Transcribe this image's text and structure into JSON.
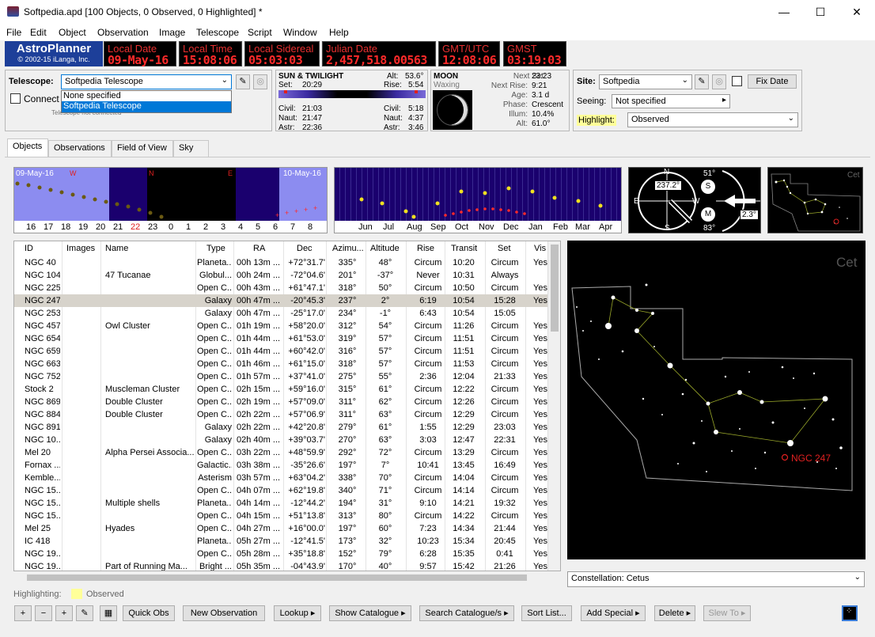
{
  "window": {
    "title": "Softpedia.apd [100 Objects, 0 Observed, 0 Highlighted] *",
    "minimize": "—",
    "maximize": "☐",
    "close": "✕"
  },
  "menu": [
    "File",
    "Edit",
    "Object",
    "Observation",
    "Image",
    "Telescope",
    "Script",
    "Window",
    "Help"
  ],
  "brand": {
    "name": "AstroPlanner",
    "copyright": "© 2002-15 iLanga, Inc."
  },
  "clocks": [
    {
      "label": "Local Date",
      "value": "09-May-16"
    },
    {
      "label": "Local Time",
      "value": "15:08:06"
    },
    {
      "label": "Local Sidereal",
      "value": "05:03:03"
    },
    {
      "label": "Julian Date",
      "value": "2,457,518.00563"
    },
    {
      "label": "GMT/UTC",
      "value": "12:08:06"
    },
    {
      "label": "GMST",
      "value": "03:19:03"
    }
  ],
  "telescope": {
    "label": "Telescope:",
    "selected": "Softpedia Telescope",
    "options": [
      "None specified",
      "Softpedia Telescope"
    ],
    "connect_label": "Connect t",
    "status": "Telescope not connected"
  },
  "sun": {
    "title": "SUN & TWILIGHT",
    "set_label": "Set:",
    "set": "20:29",
    "alt_label": "Alt:",
    "alt": "53.6°",
    "rise_label": "Rise:",
    "rise": "5:54",
    "civil_label": "Civil:",
    "civil_eve": "21:03",
    "civil_morn": "5:18",
    "naut_label": "Naut:",
    "naut_eve": "21:47",
    "naut_morn": "4:37",
    "astr_label": "Astr:",
    "astr_eve": "22:36",
    "astr_morn": "3:46"
  },
  "moon": {
    "title": "MOON",
    "phase_word": "Waxing",
    "next_set_label": "Next Set:",
    "next_set": "23:23",
    "next_rise_label": "Next Rise:",
    "next_rise": "9:21",
    "age_label": "Age:",
    "age": "3.1 d",
    "phase_label": "Phase:",
    "phase": "Crescent",
    "illum_label": "Illum:",
    "illum": "10.4%",
    "alt_label": "Alt:",
    "alt": "61.0°"
  },
  "site": {
    "label": "Site:",
    "value": "Softpedia",
    "fix_date": "Fix Date",
    "seeing_label": "Seeing:",
    "seeing": "Not specified",
    "highlight_label": "Highlight:",
    "highlight": "Observed"
  },
  "tabs": [
    "Objects",
    "Observations",
    "Field of View",
    "Sky"
  ],
  "night_chart": {
    "start_date": "09-May-16",
    "end_date": "10-May-16",
    "markers": [
      "W",
      "N",
      "E"
    ],
    "hours": [
      "16",
      "17",
      "18",
      "19",
      "20",
      "21",
      "22",
      "23",
      "0",
      "1",
      "2",
      "3",
      "4",
      "5",
      "6",
      "7",
      "8"
    ],
    "current_hour": "22"
  },
  "year_chart": {
    "months": [
      "Jun",
      "Jul",
      "Aug",
      "Sep",
      "Oct",
      "Nov",
      "Dec",
      "Jan",
      "Feb",
      "Mar",
      "Apr"
    ]
  },
  "compass": {
    "n": "N",
    "e": "E",
    "w": "W",
    "s": "S",
    "azimuth": "237.2°",
    "sun_alt": "51°",
    "sun_icon": "S",
    "moon_alt": "83°",
    "moon_icon": "M",
    "angle": "2.3°"
  },
  "mini_map_label": "Cet",
  "sky_map": {
    "constellation": "Cet",
    "target": "NGC 247"
  },
  "table": {
    "headers": [
      "ID",
      "Images",
      "Name",
      "Type",
      "RA",
      "Dec",
      "Azimu...",
      "Altitude",
      "Rise",
      "Transit",
      "Set",
      "Vis"
    ],
    "rows": [
      [
        "NGC 40",
        "",
        "",
        "Planeta...",
        "00h 13m ...",
        "+72°31.7'",
        "335°",
        "48°",
        "Circum",
        "10:20",
        "Circum",
        "Yes"
      ],
      [
        "NGC 104",
        "",
        "47 Tucanae",
        "Globul...",
        "00h 24m ...",
        "-72°04.6'",
        "201°",
        "-37°",
        "Never",
        "10:31",
        "Always",
        ""
      ],
      [
        "NGC 225",
        "",
        "",
        "Open C...",
        "00h 43m ...",
        "+61°47.1'",
        "318°",
        "50°",
        "Circum",
        "10:50",
        "Circum",
        "Yes"
      ],
      [
        "NGC 247",
        "",
        "",
        "Galaxy",
        "00h 47m ...",
        "-20°45.3'",
        "237°",
        "2°",
        "6:19",
        "10:54",
        "15:28",
        "Yes"
      ],
      [
        "NGC 253",
        "",
        "",
        "Galaxy",
        "00h 47m ...",
        "-25°17.0'",
        "234°",
        "-1°",
        "6:43",
        "10:54",
        "15:05",
        ""
      ],
      [
        "NGC 457",
        "",
        "Owl Cluster",
        "Open C...",
        "01h 19m ...",
        "+58°20.0'",
        "312°",
        "54°",
        "Circum",
        "11:26",
        "Circum",
        "Yes"
      ],
      [
        "NGC 654",
        "",
        "",
        "Open C...",
        "01h 44m ...",
        "+61°53.0'",
        "319°",
        "57°",
        "Circum",
        "11:51",
        "Circum",
        "Yes"
      ],
      [
        "NGC 659",
        "",
        "",
        "Open C...",
        "01h 44m ...",
        "+60°42.0'",
        "316°",
        "57°",
        "Circum",
        "11:51",
        "Circum",
        "Yes"
      ],
      [
        "NGC 663",
        "",
        "",
        "Open C...",
        "01h 46m ...",
        "+61°15.0'",
        "318°",
        "57°",
        "Circum",
        "11:53",
        "Circum",
        "Yes"
      ],
      [
        "NGC 752",
        "",
        "",
        "Open C...",
        "01h 57m ...",
        "+37°41.0'",
        "275°",
        "55°",
        "2:36",
        "12:04",
        "21:33",
        "Yes"
      ],
      [
        "Stock 2",
        "",
        "Muscleman Cluster",
        "Open C...",
        "02h 15m ...",
        "+59°16.0'",
        "315°",
        "61°",
        "Circum",
        "12:22",
        "Circum",
        "Yes"
      ],
      [
        "NGC 869",
        "",
        "Double Cluster",
        "Open C...",
        "02h 19m ...",
        "+57°09.0'",
        "311°",
        "62°",
        "Circum",
        "12:26",
        "Circum",
        "Yes"
      ],
      [
        "NGC 884",
        "",
        "Double Cluster",
        "Open C...",
        "02h 22m ...",
        "+57°06.9'",
        "311°",
        "63°",
        "Circum",
        "12:29",
        "Circum",
        "Yes"
      ],
      [
        "NGC 891",
        "",
        "",
        "Galaxy",
        "02h 22m ...",
        "+42°20.8'",
        "279°",
        "61°",
        "1:55",
        "12:29",
        "23:03",
        "Yes"
      ],
      [
        "NGC 10...",
        "",
        "",
        "Galaxy",
        "02h 40m ...",
        "+39°03.7'",
        "270°",
        "63°",
        "3:03",
        "12:47",
        "22:31",
        "Yes"
      ],
      [
        "Mel 20",
        "",
        "Alpha Persei Associa...",
        "Open C...",
        "03h 22m ...",
        "+48°59.9'",
        "292°",
        "72°",
        "Circum",
        "13:29",
        "Circum",
        "Yes"
      ],
      [
        "Fornax ...",
        "",
        "",
        "Galactic...",
        "03h 38m ...",
        "-35°26.6'",
        "197°",
        "7°",
        "10:41",
        "13:45",
        "16:49",
        "Yes"
      ],
      [
        "Kemble...",
        "",
        "",
        "Asterism",
        "03h 57m ...",
        "+63°04.2'",
        "338°",
        "70°",
        "Circum",
        "14:04",
        "Circum",
        "Yes"
      ],
      [
        "NGC 15...",
        "",
        "",
        "Open C...",
        "04h 07m ...",
        "+62°19.8'",
        "340°",
        "71°",
        "Circum",
        "14:14",
        "Circum",
        "Yes"
      ],
      [
        "NGC 15...",
        "",
        "Multiple shells",
        "Planeta...",
        "04h 14m ...",
        "-12°44.2'",
        "194°",
        "31°",
        "9:10",
        "14:21",
        "19:32",
        "Yes"
      ],
      [
        "NGC 15...",
        "",
        "",
        "Open C...",
        "04h 15m ...",
        "+51°13.8'",
        "313°",
        "80°",
        "Circum",
        "14:22",
        "Circum",
        "Yes"
      ],
      [
        "Mel 25",
        "",
        "Hyades",
        "Open C...",
        "04h 27m ...",
        "+16°00.0'",
        "197°",
        "60°",
        "7:23",
        "14:34",
        "21:44",
        "Yes"
      ],
      [
        "IC 418",
        "",
        "",
        "Planeta...",
        "05h 27m ...",
        "-12°41.5'",
        "173°",
        "32°",
        "10:23",
        "15:34",
        "20:45",
        "Yes"
      ],
      [
        "NGC 19...",
        "",
        "",
        "Open C...",
        "05h 28m ...",
        "+35°18.8'",
        "152°",
        "79°",
        "6:28",
        "15:35",
        "0:41",
        "Yes"
      ],
      [
        "NGC 19...",
        "",
        "Part of Running Ma...",
        "Bright ...",
        "05h 35m ...",
        "-04°43.9'",
        "170°",
        "40°",
        "9:57",
        "15:42",
        "21:26",
        "Yes"
      ]
    ],
    "selected_index": 3
  },
  "highlighting": {
    "label": "Highlighting:",
    "value": "Observed",
    "color": "#ffff99"
  },
  "constellation_combo": "Constellation: Cetus",
  "buttons": {
    "add": "+",
    "remove": "−",
    "add_multi": "+",
    "edit": "✎",
    "calc": "▦",
    "quick_obs": "Quick Obs",
    "new_obs": "New Observation",
    "lookup": "Lookup",
    "show_catalogue": "Show Catalogue",
    "search_catalogue": "Search Catalogue/s",
    "sort_list": "Sort List...",
    "add_special": "Add Special",
    "delete": "Delete",
    "slew_to": "Slew To"
  },
  "colors": {
    "lcd_red": "#ff2a2a",
    "brand_blue": "#1d3f99",
    "selection": "#0078d7",
    "map_line": "#9aa82a",
    "target": "#e02020"
  }
}
